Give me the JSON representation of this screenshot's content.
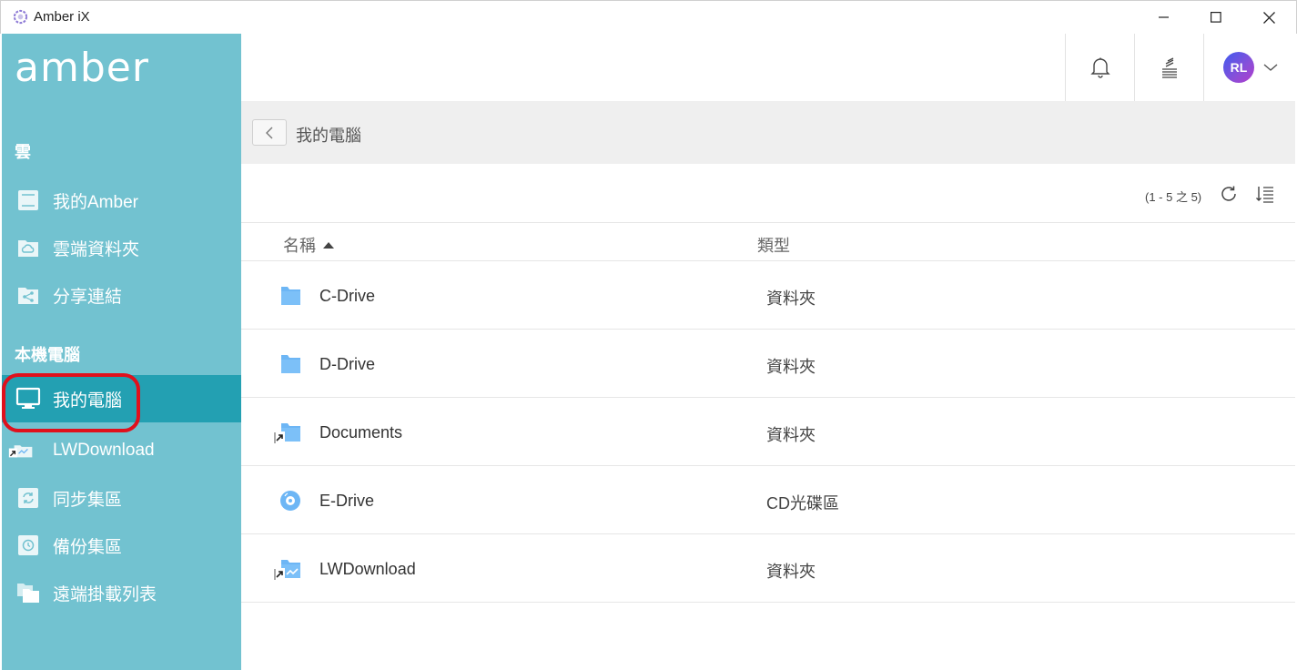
{
  "window": {
    "title": "Amber iX"
  },
  "sidebar": {
    "logo": "amber",
    "cloud_section": "雲",
    "cloud_items": [
      {
        "label": "我的Amber",
        "icon": "amber-device-icon"
      },
      {
        "label": "雲端資料夾",
        "icon": "cloud-folder-icon"
      },
      {
        "label": "分享連結",
        "icon": "share-icon"
      }
    ],
    "local_section": "本機電腦",
    "local_items": [
      {
        "label": "我的電腦",
        "icon": "monitor-icon",
        "active": true
      },
      {
        "label": "LWDownload",
        "icon": "shortcut-folder-icon"
      },
      {
        "label": "同步集區",
        "icon": "sync-icon"
      },
      {
        "label": "備份集區",
        "icon": "backup-icon"
      },
      {
        "label": "遠端掛載列表",
        "icon": "remote-folder-icon"
      }
    ]
  },
  "header": {
    "avatar_initials": "RL"
  },
  "breadcrumb": {
    "current": "我的電腦"
  },
  "toolbar": {
    "count": "(1 - 5 之 5)"
  },
  "table": {
    "columns": {
      "name": "名稱",
      "type": "類型"
    },
    "rows": [
      {
        "name": "C-Drive",
        "type": "資料夾",
        "icon": "folder-icon"
      },
      {
        "name": "D-Drive",
        "type": "資料夾",
        "icon": "folder-icon"
      },
      {
        "name": "Documents",
        "type": "資料夾",
        "icon": "shortcut-folder-icon"
      },
      {
        "name": "E-Drive",
        "type": "CD光碟區",
        "icon": "disc-icon"
      },
      {
        "name": "LWDownload",
        "type": "資料夾",
        "icon": "shortcut-folder-icon"
      }
    ]
  },
  "colors": {
    "sidebar": "#72c2d0",
    "sidebar_active": "#23a0b2",
    "folder": "#6db6f5",
    "highlight": "#e0101c"
  }
}
